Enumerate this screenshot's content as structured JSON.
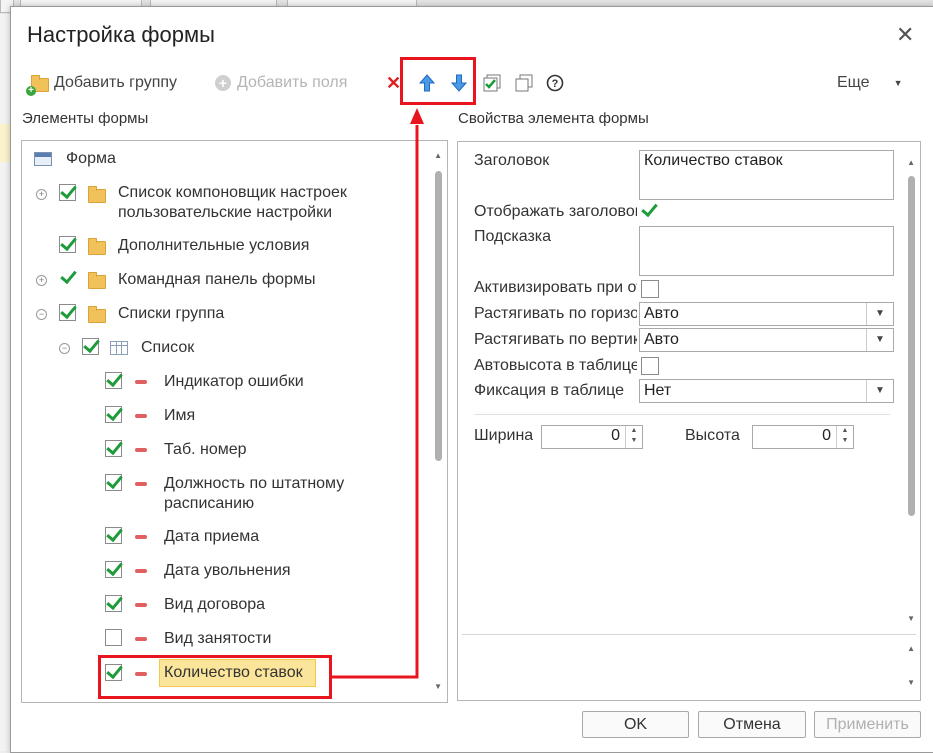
{
  "dialog": {
    "title": "Настройка формы",
    "close": "✕"
  },
  "toolbar": {
    "add_group": "Добавить группу",
    "add_fields": "Добавить поля",
    "more": "Еще"
  },
  "left": {
    "header": "Элементы формы",
    "tree": [
      {
        "label": "Форма"
      },
      {
        "label": "Список компоновщик настроек\nпользовательские настройки"
      },
      {
        "label": "Дополнительные условия"
      },
      {
        "label": "Командная панель формы"
      },
      {
        "label": "Списки группа"
      },
      {
        "label": "Список"
      },
      {
        "label": "Индикатор ошибки"
      },
      {
        "label": "Имя"
      },
      {
        "label": "Таб. номер"
      },
      {
        "label": "Должность по штатному\nрасписанию"
      },
      {
        "label": "Дата приема"
      },
      {
        "label": "Дата увольнения"
      },
      {
        "label": "Вид договора"
      },
      {
        "label": "Вид занятости"
      },
      {
        "label": "Количество ставок"
      }
    ]
  },
  "right": {
    "header": "Свойства элемента формы",
    "props": {
      "title_label": "Заголовок",
      "title_value": "Количество ставок",
      "show_title_label": "Отображать заголовок",
      "hint_label": "Подсказка",
      "hint_value": "",
      "activate_label": "Активизировать при открытии",
      "stretch_h_label": "Растягивать по горизонтали",
      "stretch_h_value": "Авто",
      "stretch_v_label": "Растягивать по вертикали",
      "stretch_v_value": "Авто",
      "autoheight_label": "Автовысота в таблице",
      "fix_label": "Фиксация в таблице",
      "fix_value": "Нет",
      "width_label": "Ширина",
      "width_value": "0",
      "height_label": "Высота",
      "height_value": "0"
    }
  },
  "buttons": {
    "ok": "OK",
    "cancel": "Отмена",
    "apply": "Применить"
  },
  "colors": {
    "highlight_red": "#e8151f",
    "check_green": "#1e9b3a",
    "arrow_blue": "#2f7fd6"
  }
}
